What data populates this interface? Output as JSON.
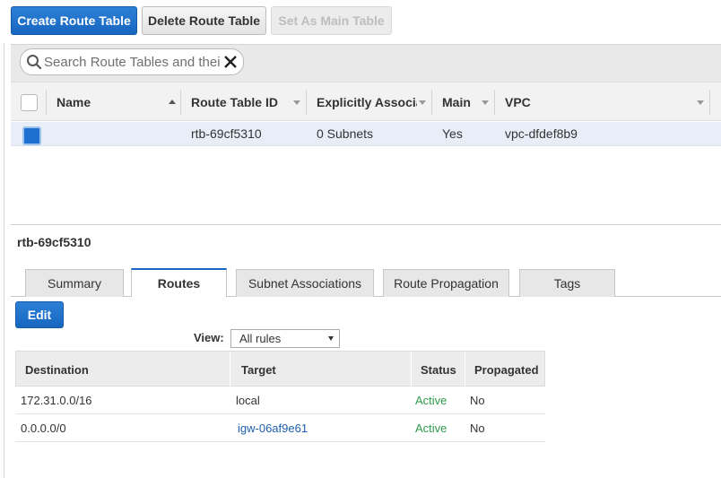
{
  "toolbar": {
    "create_label": "Create Route Table",
    "delete_label": "Delete Route Table",
    "set_main_label": "Set As Main Table"
  },
  "search": {
    "placeholder": "Search Route Tables and their"
  },
  "table": {
    "columns": {
      "name": "Name",
      "route_table_id": "Route Table ID",
      "explicitly_associated": "Explicitly Associat",
      "main": "Main",
      "vpc": "VPC"
    },
    "rows": [
      {
        "name": "",
        "route_table_id": "rtb-69cf5310",
        "explicitly_associated": "0 Subnets",
        "main": "Yes",
        "vpc": "vpc-dfdef8b9",
        "selected": true
      }
    ]
  },
  "detail": {
    "title": "rtb-69cf5310",
    "tabs": [
      "Summary",
      "Routes",
      "Subnet Associations",
      "Route Propagation",
      "Tags"
    ],
    "active_tab": "Routes",
    "edit_label": "Edit",
    "view_label": "View:",
    "view_value": "All rules",
    "routes": {
      "columns": {
        "destination": "Destination",
        "target": "Target",
        "status": "Status",
        "propagated": "Propagated"
      },
      "rows": [
        {
          "destination": "172.31.0.0/16",
          "target": "local",
          "status": "Active",
          "propagated": "No"
        },
        {
          "destination": "0.0.0.0/0",
          "target": "igw-06af9e61",
          "status": "Active",
          "propagated": "No"
        }
      ]
    }
  },
  "colors": {
    "primary": "#1766c0",
    "selected_row": "#e8eef8",
    "active_status": "#2e9b4a",
    "link": "#1e5fae"
  }
}
